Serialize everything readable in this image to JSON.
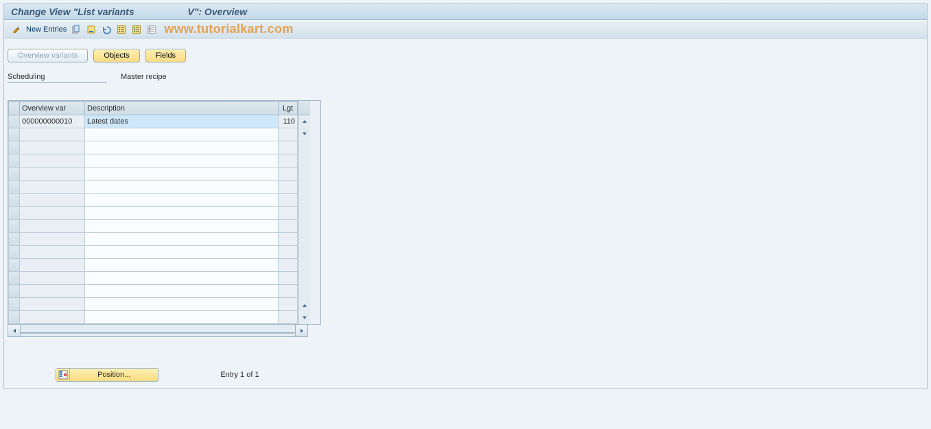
{
  "header": {
    "title": "Change View \"List variants                    V\": Overview"
  },
  "toolbar": {
    "new_entries_label": "New Entries"
  },
  "watermark": "www.tutorialkart.com",
  "tabs": {
    "overview_variants": "Overview variants",
    "objects": "Objects",
    "fields": "Fields"
  },
  "info": {
    "scheduling_label": "Scheduling",
    "master_recipe_label": "Master recipe"
  },
  "table": {
    "headers": {
      "overview_var": "Overview var",
      "description": "Description",
      "lgt": "Lgt"
    },
    "rows": [
      {
        "overview_var": "000000000010",
        "description": "Latest dates",
        "lgt": "110"
      }
    ]
  },
  "footer": {
    "position_label": "Position...",
    "entry_text": "Entry 1 of 1"
  }
}
